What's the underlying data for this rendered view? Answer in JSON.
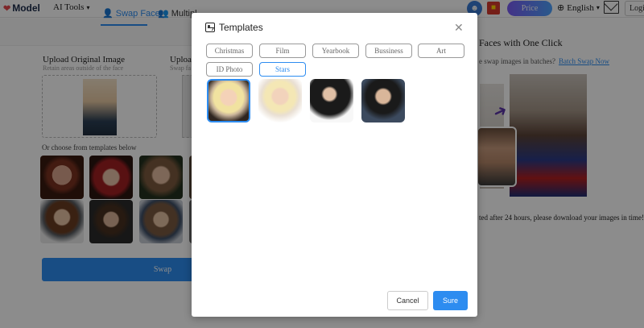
{
  "header": {
    "logo_text": "Model",
    "ai_tools_label": "AI Tools",
    "price_label": "Price",
    "language_label": "English",
    "login_label": "Login"
  },
  "left": {
    "tab_swap_face": "Swap Face",
    "tab_multiple": "Multipl",
    "upload_original_title": "Upload Original Image",
    "upload_original_sub": "Retain areas outside of the face",
    "upload_second_title": "Upload",
    "upload_second_sub": "Swap fa",
    "choose_templates_text": "Or choose from templates below",
    "swap_button": "Swap"
  },
  "right": {
    "title": "Faces with One Click",
    "batch_text": "e swap images in batches?",
    "batch_link": "Batch Swap Now",
    "warning_text": "ted after 24 hours, please download your images in time!"
  },
  "modal": {
    "title": "Templates",
    "categories": [
      "Christmas",
      "Film",
      "Yearbook",
      "Bussiness",
      "Art",
      "ID Photo",
      "Stars"
    ],
    "active_category": "Stars",
    "cancel_label": "Cancel",
    "sure_label": "Sure"
  },
  "colors": {
    "accent": "#2d8cf0",
    "overlay": "rgba(0,0,0,0.45)"
  }
}
